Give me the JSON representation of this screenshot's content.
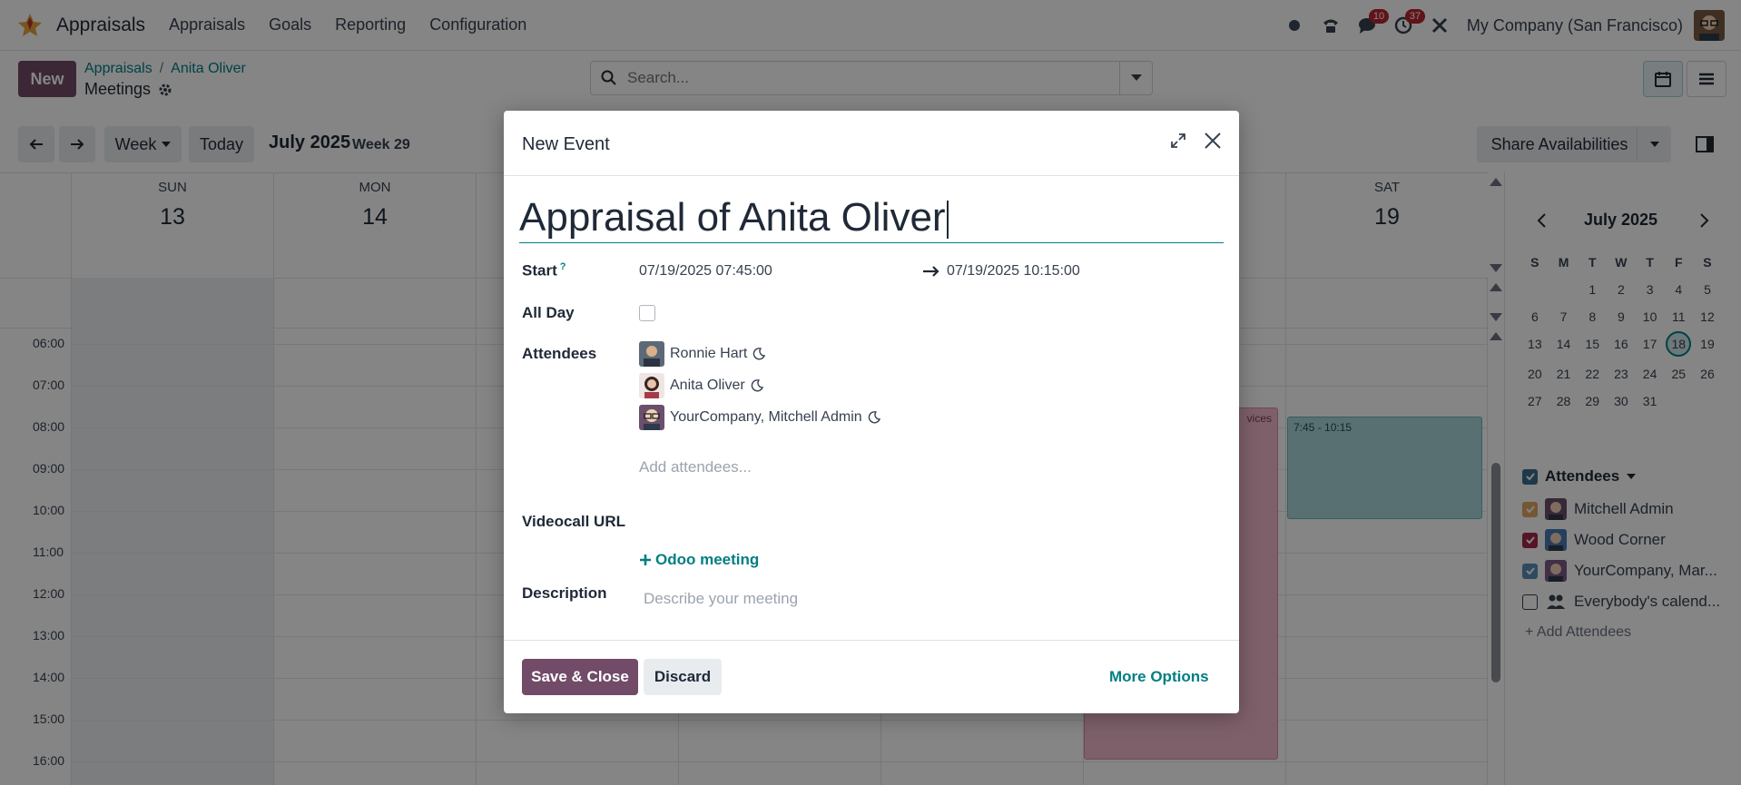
{
  "navbar": {
    "app_name": "Appraisals",
    "menu": [
      "Appraisals",
      "Goals",
      "Reporting",
      "Configuration"
    ],
    "messages_count": "10",
    "activities_count": "37",
    "company": "My Company (San Francisco)"
  },
  "control_panel": {
    "new_label": "New",
    "breadcrumb": [
      "Appraisals",
      "Anita Oliver"
    ],
    "page_title": "Meetings",
    "search_placeholder": "Search..."
  },
  "calendar": {
    "scale_label": "Week",
    "today_label": "Today",
    "title": "July 2025",
    "week_label": "Week 29",
    "share_label": "Share Availabilities",
    "days": [
      {
        "name": "SUN",
        "num": "13"
      },
      {
        "name": "MON",
        "num": "14"
      },
      {
        "name": "",
        "num": ""
      },
      {
        "name": "",
        "num": ""
      },
      {
        "name": "",
        "num": ""
      },
      {
        "name": "",
        "num": ""
      },
      {
        "name": "SAT",
        "num": "19"
      }
    ],
    "hours": [
      "06:00",
      "07:00",
      "08:00",
      "09:00",
      "10:00",
      "11:00",
      "12:00",
      "13:00",
      "14:00",
      "15:00",
      "16:00"
    ],
    "events": [
      {
        "label": "vices",
        "color": "#f2b8cb"
      },
      {
        "label": "7:45 - 10:15",
        "color": "#a9d6da"
      }
    ]
  },
  "sidebar": {
    "mini_title": "July 2025",
    "weekday_headers": [
      "S",
      "M",
      "T",
      "W",
      "T",
      "F",
      "S"
    ],
    "weeks": [
      [
        "",
        "",
        "1",
        "2",
        "3",
        "4",
        "5"
      ],
      [
        "6",
        "7",
        "8",
        "9",
        "10",
        "11",
        "12"
      ],
      [
        "13",
        "14",
        "15",
        "16",
        "17",
        "18",
        "19"
      ],
      [
        "20",
        "21",
        "22",
        "23",
        "24",
        "25",
        "26"
      ],
      [
        "27",
        "28",
        "29",
        "30",
        "31",
        "",
        ""
      ]
    ],
    "today": "18",
    "attendees_title": "Attendees",
    "attendees": [
      {
        "name": "Mitchell Admin",
        "color": "#e2a764",
        "checked": true
      },
      {
        "name": "Wood Corner",
        "color": "#a52a4a",
        "checked": true
      },
      {
        "name": "YourCompany, Mar...",
        "color": "#5b8fb9",
        "checked": true
      },
      {
        "name": "Everybody's calend...",
        "color": "#ffffff",
        "checked": false
      }
    ],
    "add_attendees": "+ Add Attendees"
  },
  "modal": {
    "title": "New Event",
    "event_name": "Appraisal of Anita Oliver",
    "start_label": "Start",
    "start_help": "?",
    "start_value": "07/19/2025 07:45:00",
    "end_value": "07/19/2025 10:15:00",
    "allday_label": "All Day",
    "attendees_label": "Attendees",
    "attendees": [
      "Ronnie Hart",
      "Anita Oliver",
      "YourCompany, Mitchell Admin"
    ],
    "add_attendees_placeholder": "Add attendees...",
    "videocall_label": "Videocall URL",
    "odoo_meeting": "Odoo meeting",
    "description_label": "Description",
    "description_placeholder": "Describe your meeting",
    "save_label": "Save & Close",
    "discard_label": "Discard",
    "more_label": "More Options"
  }
}
